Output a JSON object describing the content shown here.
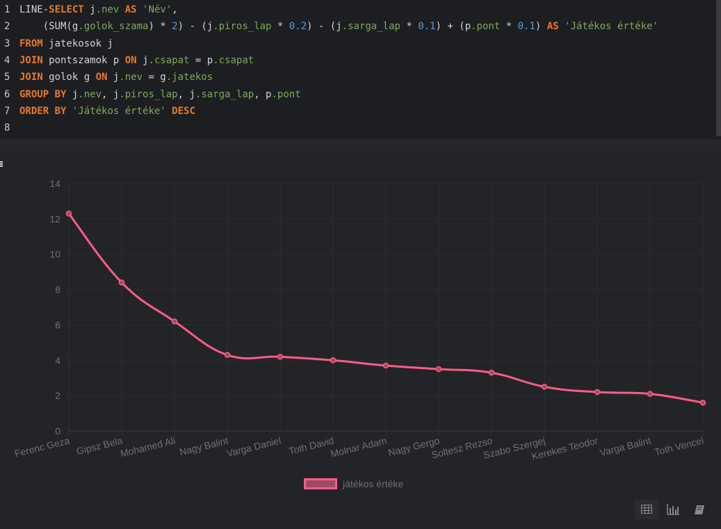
{
  "editor": {
    "lines": [
      {
        "num": "1",
        "tokens": [
          {
            "t": "LINE-",
            "c": "id"
          },
          {
            "t": "SELECT",
            "c": "kw"
          },
          {
            "t": " j",
            "c": "id"
          },
          {
            "t": ".nev",
            "c": "fld"
          },
          {
            "t": " ",
            "c": "id"
          },
          {
            "t": "AS",
            "c": "kw"
          },
          {
            "t": " ",
            "c": "id"
          },
          {
            "t": "'Név'",
            "c": "str"
          },
          {
            "t": ",",
            "c": "id"
          }
        ]
      },
      {
        "num": "2",
        "tokens": [
          {
            "t": "    (SUM(g",
            "c": "id"
          },
          {
            "t": ".golok_szama",
            "c": "fld"
          },
          {
            "t": ") * ",
            "c": "id"
          },
          {
            "t": "2",
            "c": "num"
          },
          {
            "t": ") - (j",
            "c": "id"
          },
          {
            "t": ".piros_lap",
            "c": "fld"
          },
          {
            "t": " * ",
            "c": "id"
          },
          {
            "t": "0.2",
            "c": "num"
          },
          {
            "t": ") - (j",
            "c": "id"
          },
          {
            "t": ".sarga_lap",
            "c": "fld"
          },
          {
            "t": " * ",
            "c": "id"
          },
          {
            "t": "0.1",
            "c": "num"
          },
          {
            "t": ") + (p",
            "c": "id"
          },
          {
            "t": ".pont",
            "c": "fld"
          },
          {
            "t": " * ",
            "c": "id"
          },
          {
            "t": "0.1",
            "c": "num"
          },
          {
            "t": ") ",
            "c": "id"
          },
          {
            "t": "AS",
            "c": "kw"
          },
          {
            "t": " ",
            "c": "id"
          },
          {
            "t": "'Játékos értéke'",
            "c": "str"
          }
        ]
      },
      {
        "num": "3",
        "tokens": [
          {
            "t": "FROM",
            "c": "kw"
          },
          {
            "t": " jatekosok j",
            "c": "id"
          }
        ]
      },
      {
        "num": "4",
        "tokens": [
          {
            "t": "JOIN",
            "c": "kw"
          },
          {
            "t": " pontszamok p ",
            "c": "id"
          },
          {
            "t": "ON",
            "c": "kw"
          },
          {
            "t": " j",
            "c": "id"
          },
          {
            "t": ".csapat",
            "c": "fld"
          },
          {
            "t": " = p",
            "c": "id"
          },
          {
            "t": ".csapat",
            "c": "fld"
          }
        ]
      },
      {
        "num": "5",
        "tokens": [
          {
            "t": "JOIN",
            "c": "kw"
          },
          {
            "t": " golok g ",
            "c": "id"
          },
          {
            "t": "ON",
            "c": "kw"
          },
          {
            "t": " j",
            "c": "id"
          },
          {
            "t": ".nev",
            "c": "fld"
          },
          {
            "t": " = g",
            "c": "id"
          },
          {
            "t": ".jatekos",
            "c": "fld"
          }
        ]
      },
      {
        "num": "6",
        "tokens": [
          {
            "t": "GROUP BY",
            "c": "kw"
          },
          {
            "t": " j",
            "c": "id"
          },
          {
            "t": ".nev",
            "c": "fld"
          },
          {
            "t": ", j",
            "c": "id"
          },
          {
            "t": ".piros_lap",
            "c": "fld"
          },
          {
            "t": ", j",
            "c": "id"
          },
          {
            "t": ".sarga_lap",
            "c": "fld"
          },
          {
            "t": ", p",
            "c": "id"
          },
          {
            "t": ".pont",
            "c": "fld"
          }
        ]
      },
      {
        "num": "7",
        "tokens": [
          {
            "t": "ORDER BY",
            "c": "kw"
          },
          {
            "t": " ",
            "c": "id"
          },
          {
            "t": "'Játékos értéke'",
            "c": "str"
          },
          {
            "t": " ",
            "c": "id"
          },
          {
            "t": "DESC",
            "c": "kw"
          }
        ]
      },
      {
        "num": "8",
        "tokens": []
      }
    ]
  },
  "chart_data": {
    "type": "line",
    "categories": [
      "Ferenc Geza",
      "Gipsz Bela",
      "Mohamed Ali",
      "Nagy Balint",
      "Varga Daniel",
      "Toth David",
      "Molnar Adam",
      "Nagy Gergo",
      "Soltesz Rezso",
      "Szabo Szergej",
      "Kerekes Teodor",
      "Varga Balint",
      "Toth Vencel"
    ],
    "series": [
      {
        "name": "játékos értéke",
        "values": [
          12.3,
          8.4,
          6.2,
          4.3,
          4.2,
          4.0,
          3.7,
          3.5,
          3.3,
          2.5,
          2.2,
          2.1,
          1.6
        ]
      }
    ],
    "ylim": [
      0,
      14
    ],
    "yticks": [
      0,
      2,
      4,
      6,
      8,
      10,
      12,
      14
    ],
    "grid": true,
    "legend": "bottom-center",
    "line_color": "#ff5c86"
  },
  "legend": {
    "label": "játékos értéke"
  },
  "toolbar": {
    "icons": [
      "table-icon",
      "bar-chart-icon",
      "book-icon"
    ]
  }
}
